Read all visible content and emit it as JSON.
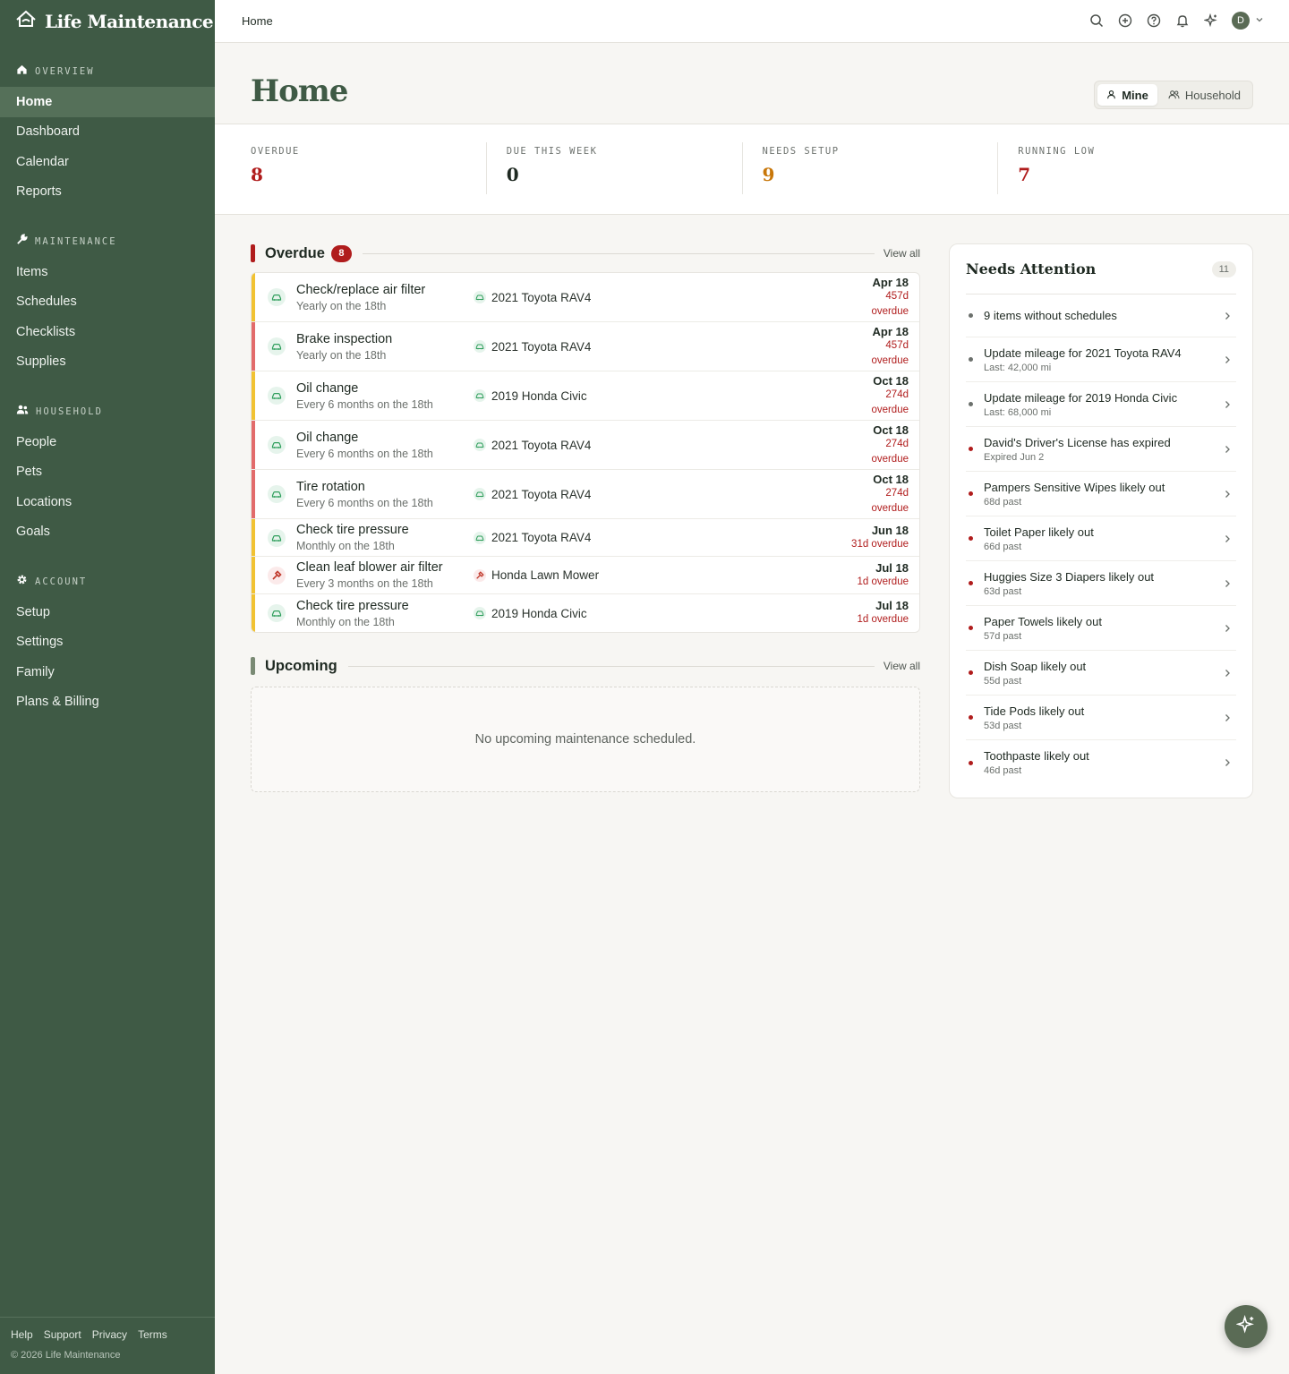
{
  "app": {
    "name": "Life Maintenance"
  },
  "sidebar": {
    "sections": [
      {
        "title": "OVERVIEW",
        "icon": "home-icon",
        "items": [
          "Home",
          "Dashboard",
          "Calendar",
          "Reports"
        ]
      },
      {
        "title": "MAINTENANCE",
        "icon": "wrench-icon",
        "items": [
          "Items",
          "Schedules",
          "Checklists",
          "Supplies"
        ]
      },
      {
        "title": "HOUSEHOLD",
        "icon": "people-icon",
        "items": [
          "People",
          "Pets",
          "Locations",
          "Goals"
        ]
      },
      {
        "title": "ACCOUNT",
        "icon": "gear-icon",
        "items": [
          "Setup",
          "Settings",
          "Family",
          "Plans & Billing"
        ]
      }
    ],
    "active": "Home",
    "footer_links": [
      "Help",
      "Support",
      "Privacy",
      "Terms"
    ],
    "copyright": "© 2026 Life Maintenance"
  },
  "topbar": {
    "breadcrumb": "Home",
    "avatar_initial": "D"
  },
  "header": {
    "title": "Home",
    "toggle": {
      "mine": "Mine",
      "household": "Household",
      "selected": "Mine"
    }
  },
  "stats": [
    {
      "label": "OVERDUE",
      "value": "8",
      "color": "#b01c1c"
    },
    {
      "label": "DUE THIS WEEK",
      "value": "0",
      "color": "#1f2a22"
    },
    {
      "label": "NEEDS SETUP",
      "value": "9",
      "color": "#c8770a"
    },
    {
      "label": "RUNNING LOW",
      "value": "7",
      "color": "#b01c1c"
    }
  ],
  "overdue": {
    "title": "Overdue",
    "count": "8",
    "view_all": "View all",
    "items": [
      {
        "name": "Check/replace air filter",
        "schedule": "Yearly on the 18th",
        "asset": "2021 Toyota RAV4",
        "asset_type": "car",
        "date": "Apr 18",
        "status_lines": [
          "457d",
          "overdue"
        ],
        "accent": "#f1c232"
      },
      {
        "name": "Brake inspection",
        "schedule": "Yearly on the 18th",
        "asset": "2021 Toyota RAV4",
        "asset_type": "car",
        "date": "Apr 18",
        "status_lines": [
          "457d",
          "overdue"
        ],
        "accent": "#e26b6b"
      },
      {
        "name": "Oil change",
        "schedule": "Every 6 months on the 18th",
        "asset": "2019 Honda Civic",
        "asset_type": "car",
        "date": "Oct 18",
        "status_lines": [
          "274d",
          "overdue"
        ],
        "accent": "#f1c232"
      },
      {
        "name": "Oil change",
        "schedule": "Every 6 months on the 18th",
        "asset": "2021 Toyota RAV4",
        "asset_type": "car",
        "date": "Oct 18",
        "status_lines": [
          "274d",
          "overdue"
        ],
        "accent": "#e26b6b"
      },
      {
        "name": "Tire rotation",
        "schedule": "Every 6 months on the 18th",
        "asset": "2021 Toyota RAV4",
        "asset_type": "car",
        "date": "Oct 18",
        "status_lines": [
          "274d",
          "overdue"
        ],
        "accent": "#e26b6b"
      },
      {
        "name": "Check tire pressure",
        "schedule": "Monthly on the 18th",
        "asset": "2021 Toyota RAV4",
        "asset_type": "car",
        "date": "Jun 18",
        "status_lines": [
          "31d overdue"
        ],
        "accent": "#f1c232"
      },
      {
        "name": "Clean leaf blower air filter",
        "schedule": "Every 3 months on the 18th",
        "asset": "Honda Lawn Mower",
        "asset_type": "tool",
        "date": "Jul 18",
        "status_lines": [
          "1d overdue"
        ],
        "accent": "#f1c232"
      },
      {
        "name": "Check tire pressure",
        "schedule": "Monthly on the 18th",
        "asset": "2019 Honda Civic",
        "asset_type": "car",
        "date": "Jul 18",
        "status_lines": [
          "1d overdue"
        ],
        "accent": "#f1c232"
      }
    ]
  },
  "upcoming": {
    "title": "Upcoming",
    "view_all": "View all",
    "empty": "No upcoming maintenance scheduled."
  },
  "needs_attention": {
    "title": "Needs Attention",
    "count": "11",
    "items": [
      {
        "title": "9 items without schedules",
        "sub": "",
        "dot": "#6b706c"
      },
      {
        "title": "Update mileage for 2021 Toyota RAV4",
        "sub": "Last: 42,000 mi",
        "dot": "#6b706c"
      },
      {
        "title": "Update mileage for 2019 Honda Civic",
        "sub": "Last: 68,000 mi",
        "dot": "#6b706c"
      },
      {
        "title": "David's Driver's License has expired",
        "sub": "Expired Jun 2",
        "dot": "#b01c1c"
      },
      {
        "title": "Pampers Sensitive Wipes likely out",
        "sub": "68d past",
        "dot": "#b01c1c"
      },
      {
        "title": "Toilet Paper likely out",
        "sub": "66d past",
        "dot": "#b01c1c"
      },
      {
        "title": "Huggies Size 3 Diapers likely out",
        "sub": "63d past",
        "dot": "#b01c1c"
      },
      {
        "title": "Paper Towels likely out",
        "sub": "57d past",
        "dot": "#b01c1c"
      },
      {
        "title": "Dish Soap likely out",
        "sub": "55d past",
        "dot": "#b01c1c"
      },
      {
        "title": "Tide Pods likely out",
        "sub": "53d past",
        "dot": "#b01c1c"
      },
      {
        "title": "Toothpaste likely out",
        "sub": "46d past",
        "dot": "#b01c1c"
      }
    ]
  },
  "colors": {
    "sidebar_bg": "#3f5a45",
    "brand_green": "#3f5a45",
    "danger": "#b01c1c",
    "warning": "#c8770a"
  }
}
